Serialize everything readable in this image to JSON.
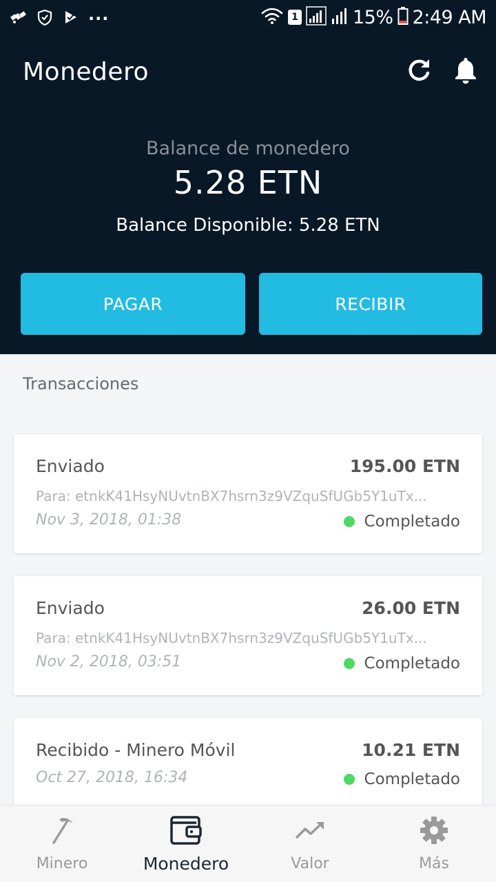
{
  "status_bar": {
    "dots": "...",
    "sim": "1",
    "battery": "15%",
    "time": "2:49 AM"
  },
  "header": {
    "title": "Monedero",
    "icons": [
      "refresh-icon",
      "bell-icon"
    ]
  },
  "balance": {
    "label": "Balance de monedero",
    "value": "5.28 ETN",
    "available": "Balance Disponible: 5.28 ETN"
  },
  "actions": {
    "pay_label": "PAGAR",
    "receive_label": "RECIBIR"
  },
  "transactions": {
    "title": "Transacciones",
    "items": [
      {
        "type": "Enviado",
        "amount": "195.00 ETN",
        "to": "Para: etnkK41HsyNUvtnBX7hsrn3z9VZquSfUGb5Y1uTx...",
        "date": "Nov 3, 2018, 01:38",
        "status": "Completado"
      },
      {
        "type": "Enviado",
        "amount": "26.00 ETN",
        "to": "Para: etnkK41HsyNUvtnBX7hsrn3z9VZquSfUGb5Y1uTx...",
        "date": "Nov 2, 2018, 03:51",
        "status": "Completado"
      },
      {
        "type": "Recibido - Minero Móvil",
        "amount": "10.21 ETN",
        "date": "Oct 27, 2018, 16:34",
        "status": "Completado"
      }
    ]
  },
  "bottom_nav": {
    "items": [
      {
        "label": "Minero",
        "icon": "pickaxe-icon"
      },
      {
        "label": "Monedero",
        "icon": "wallet-icon"
      },
      {
        "label": "Valor",
        "icon": "trend-up-icon"
      },
      {
        "label": "Más",
        "icon": "gear-icon"
      }
    ]
  },
  "colors": {
    "header_bg": "#081827",
    "accent": "#22bce3",
    "status_completed": "#4cd964"
  }
}
